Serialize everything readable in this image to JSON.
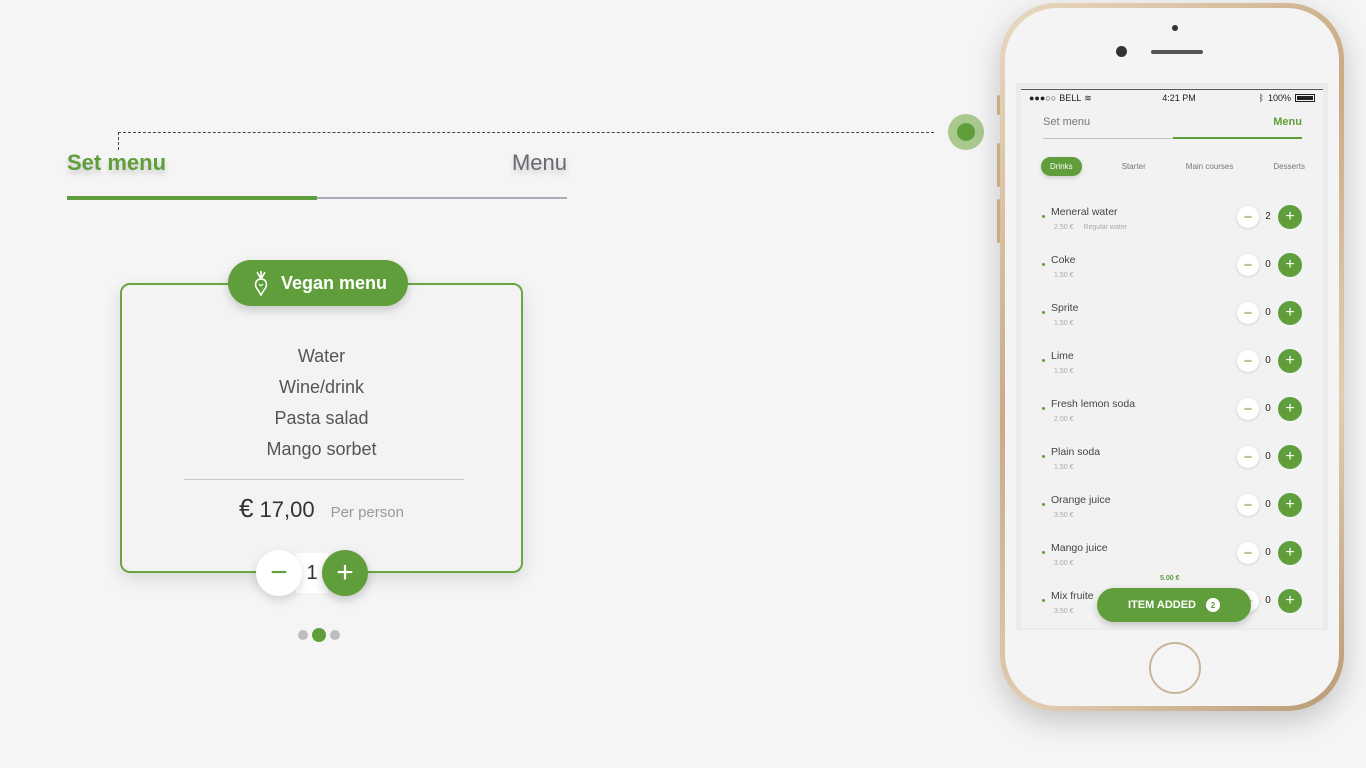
{
  "main_tabs": {
    "active": "Set menu",
    "other": "Menu"
  },
  "set_menu_card": {
    "badge_label": "Vegan menu",
    "items": [
      "Water",
      "Wine/drink",
      "Pasta salad",
      "Mango sorbet"
    ],
    "currency": "€",
    "price": "17,00",
    "price_note": "Per person",
    "quantity": "1",
    "minus_symbol": "−",
    "plus_symbol": "+"
  },
  "pager": {
    "total": 3,
    "active_index": 1
  },
  "phone": {
    "status": {
      "carrier": "BELL",
      "time": "4:21 PM",
      "battery": "100%"
    },
    "tabs": {
      "inactive": "Set menu",
      "active": "Menu"
    },
    "categories": [
      "Drinks",
      "Starter",
      "Main courses",
      "Desserts"
    ],
    "active_category": "Drinks",
    "items": [
      {
        "name": "Meneral water",
        "price": "2.50 €",
        "desc": "Regular water",
        "qty": "2"
      },
      {
        "name": "Coke",
        "price": "1.50 €",
        "desc": "",
        "qty": "0"
      },
      {
        "name": "Sprite",
        "price": "1.50 €",
        "desc": "",
        "qty": "0"
      },
      {
        "name": "Lime",
        "price": "1.50 €",
        "desc": "",
        "qty": "0"
      },
      {
        "name": "Fresh lemon soda",
        "price": "2.00 €",
        "desc": "",
        "qty": "0"
      },
      {
        "name": "Plain soda",
        "price": "1.50 €",
        "desc": "",
        "qty": "0"
      },
      {
        "name": "Orange juice",
        "price": "3.50 €",
        "desc": "",
        "qty": "0"
      },
      {
        "name": "Mango juice",
        "price": "3.00 €",
        "desc": "",
        "qty": "0"
      },
      {
        "name": "Mix fruite",
        "price": "3.50 €",
        "desc": "",
        "qty": "0"
      }
    ],
    "total_amount": "5.00 €",
    "item_added_label": "ITEM ADDED",
    "item_added_count": "2"
  },
  "colors": {
    "accent": "#5f9e3a",
    "background": "#f5f5f5"
  }
}
